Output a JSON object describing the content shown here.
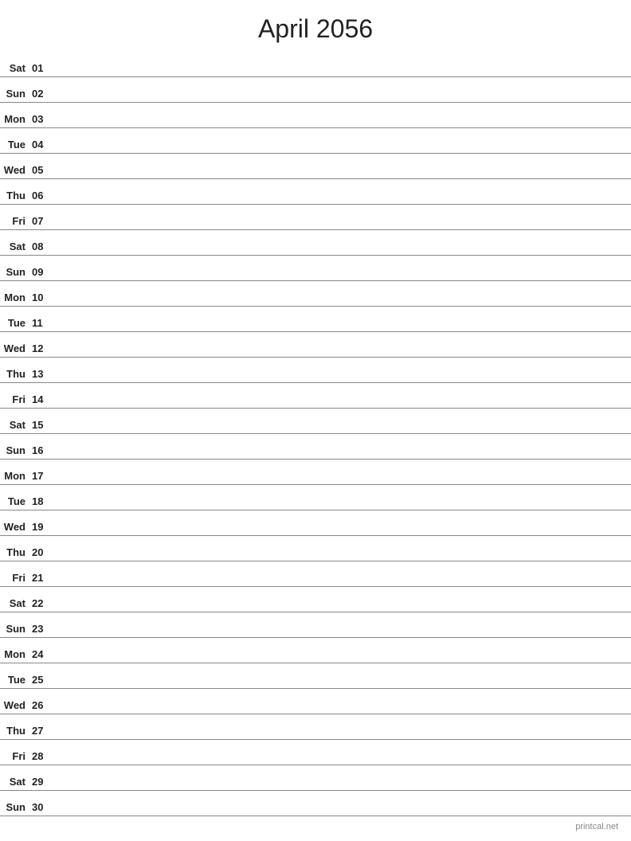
{
  "header": {
    "title": "April 2056"
  },
  "days": [
    {
      "day": "Sat",
      "date": "01"
    },
    {
      "day": "Sun",
      "date": "02"
    },
    {
      "day": "Mon",
      "date": "03"
    },
    {
      "day": "Tue",
      "date": "04"
    },
    {
      "day": "Wed",
      "date": "05"
    },
    {
      "day": "Thu",
      "date": "06"
    },
    {
      "day": "Fri",
      "date": "07"
    },
    {
      "day": "Sat",
      "date": "08"
    },
    {
      "day": "Sun",
      "date": "09"
    },
    {
      "day": "Mon",
      "date": "10"
    },
    {
      "day": "Tue",
      "date": "11"
    },
    {
      "day": "Wed",
      "date": "12"
    },
    {
      "day": "Thu",
      "date": "13"
    },
    {
      "day": "Fri",
      "date": "14"
    },
    {
      "day": "Sat",
      "date": "15"
    },
    {
      "day": "Sun",
      "date": "16"
    },
    {
      "day": "Mon",
      "date": "17"
    },
    {
      "day": "Tue",
      "date": "18"
    },
    {
      "day": "Wed",
      "date": "19"
    },
    {
      "day": "Thu",
      "date": "20"
    },
    {
      "day": "Fri",
      "date": "21"
    },
    {
      "day": "Sat",
      "date": "22"
    },
    {
      "day": "Sun",
      "date": "23"
    },
    {
      "day": "Mon",
      "date": "24"
    },
    {
      "day": "Tue",
      "date": "25"
    },
    {
      "day": "Wed",
      "date": "26"
    },
    {
      "day": "Thu",
      "date": "27"
    },
    {
      "day": "Fri",
      "date": "28"
    },
    {
      "day": "Sat",
      "date": "29"
    },
    {
      "day": "Sun",
      "date": "30"
    }
  ],
  "footer": {
    "brand": "printcal.net"
  }
}
